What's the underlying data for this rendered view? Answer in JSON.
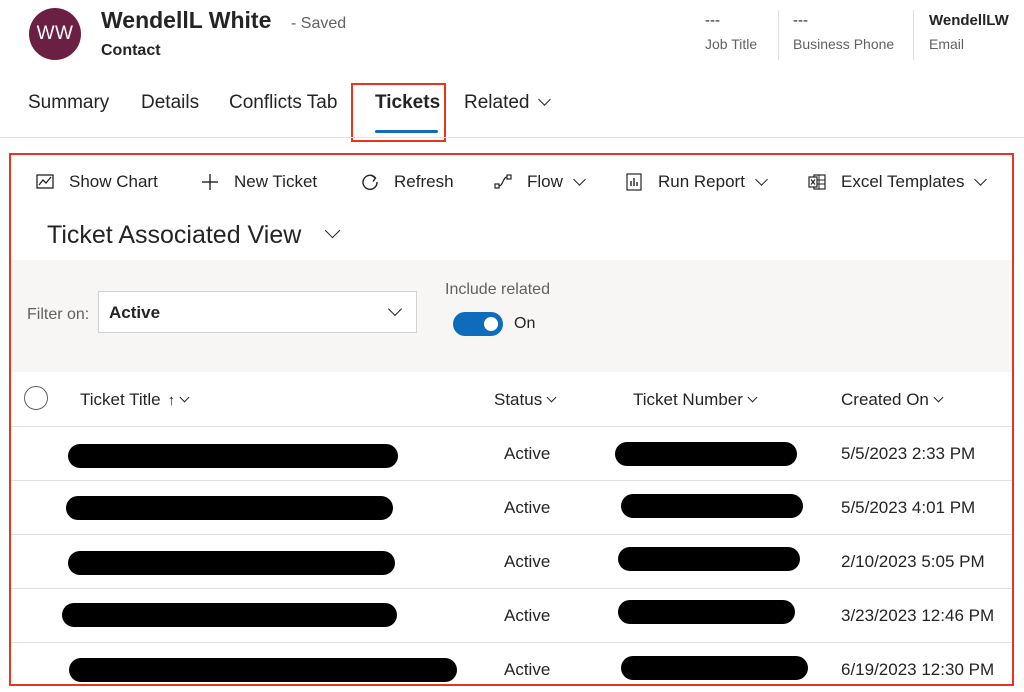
{
  "record": {
    "initials": "WW",
    "name": "WendellL White",
    "saved_status": "- Saved",
    "entity": "Contact",
    "fields": [
      {
        "value": "---",
        "label": "Job Title"
      },
      {
        "value": "---",
        "label": "Business Phone"
      },
      {
        "value": "WendellLW",
        "label": "Email"
      }
    ]
  },
  "tabs": [
    "Summary",
    "Details",
    "Conflicts Tab",
    "Tickets",
    "Related"
  ],
  "active_tab": "Tickets",
  "commands": {
    "show_chart": "Show Chart",
    "new_ticket": "New Ticket",
    "refresh": "Refresh",
    "flow": "Flow",
    "run_report": "Run Report",
    "excel_templates": "Excel Templates"
  },
  "view": {
    "title": "Ticket Associated View",
    "filter_label": "Filter on:",
    "filter_value": "Active",
    "include_related_label": "Include related",
    "include_related_state": "On"
  },
  "grid": {
    "columns": [
      "Ticket Title",
      "Status",
      "Ticket Number",
      "Created On"
    ],
    "sort_indicator": "↑",
    "rows": [
      {
        "status": "Active",
        "created_on": "5/5/2023 2:33 PM"
      },
      {
        "status": "Active",
        "created_on": "5/5/2023 4:01 PM"
      },
      {
        "status": "Active",
        "created_on": "2/10/2023 5:05 PM"
      },
      {
        "status": "Active",
        "created_on": "3/23/2023 12:46 PM"
      },
      {
        "status": "Active",
        "created_on": "6/19/2023 12:30 PM"
      }
    ]
  },
  "colors": {
    "accent": "#0f6cbd",
    "avatar": "#6b2043",
    "highlight": "#e8361d"
  }
}
